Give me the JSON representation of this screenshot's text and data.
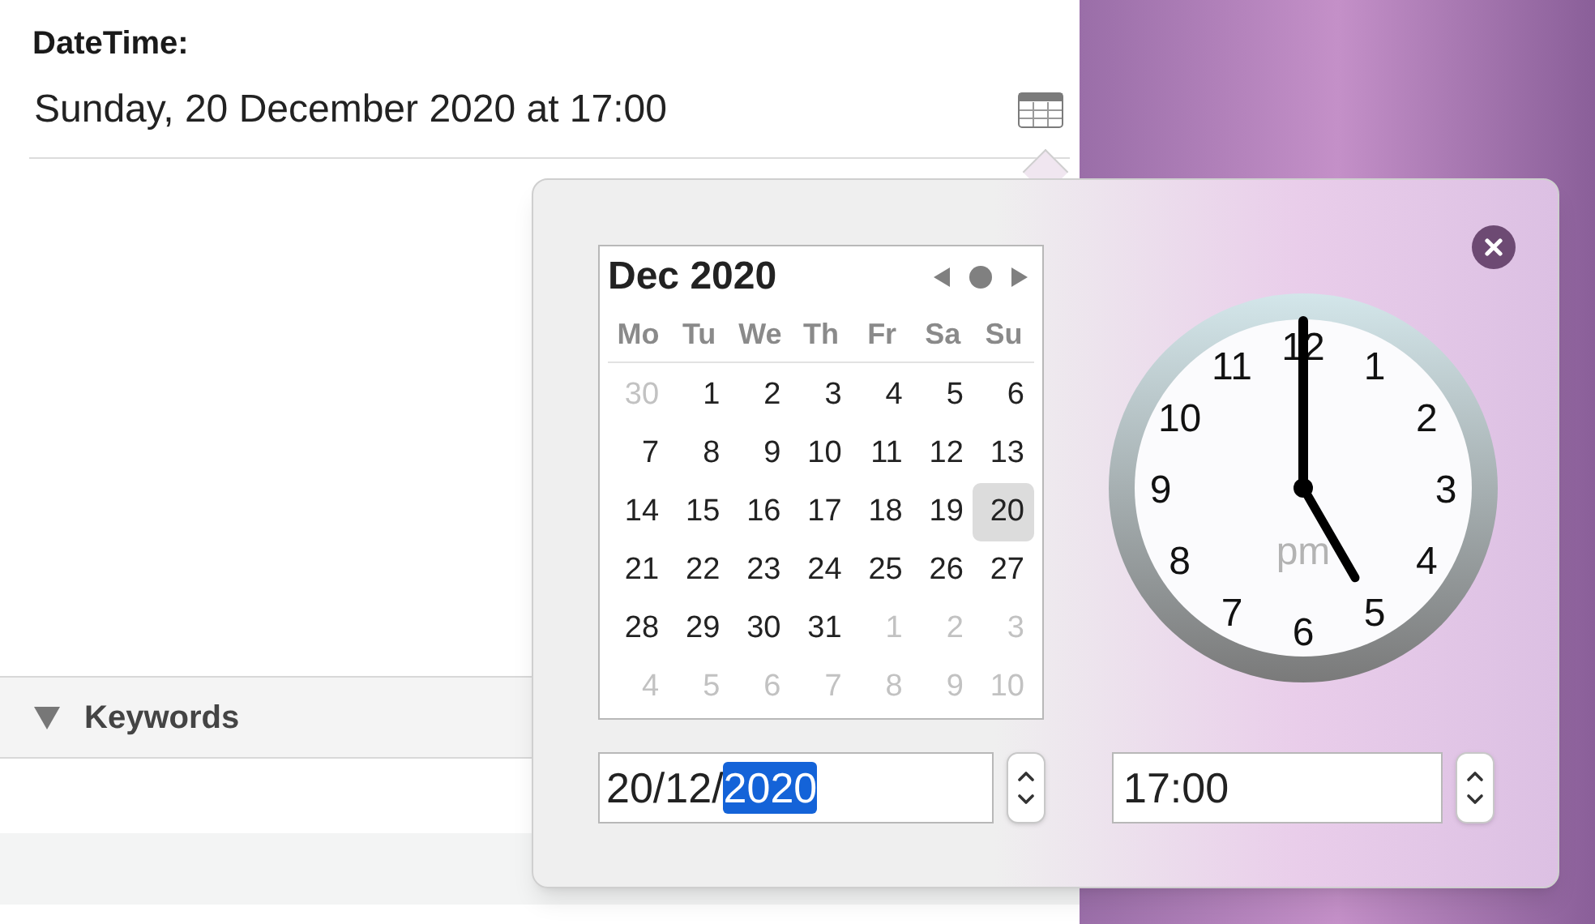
{
  "field": {
    "label": "DateTime:",
    "value": "Sunday, 20 December 2020 at 17:00"
  },
  "section": {
    "title": "Keywords",
    "expanded": true
  },
  "popover": {
    "calendar": {
      "title": "Dec 2020",
      "weekdays": [
        "Mo",
        "Tu",
        "We",
        "Th",
        "Fr",
        "Sa",
        "Su"
      ],
      "days": [
        {
          "label": "30",
          "muted": true,
          "selected": false
        },
        {
          "label": "1",
          "muted": false,
          "selected": false
        },
        {
          "label": "2",
          "muted": false,
          "selected": false
        },
        {
          "label": "3",
          "muted": false,
          "selected": false
        },
        {
          "label": "4",
          "muted": false,
          "selected": false
        },
        {
          "label": "5",
          "muted": false,
          "selected": false
        },
        {
          "label": "6",
          "muted": false,
          "selected": false
        },
        {
          "label": "7",
          "muted": false,
          "selected": false
        },
        {
          "label": "8",
          "muted": false,
          "selected": false
        },
        {
          "label": "9",
          "muted": false,
          "selected": false
        },
        {
          "label": "10",
          "muted": false,
          "selected": false
        },
        {
          "label": "11",
          "muted": false,
          "selected": false
        },
        {
          "label": "12",
          "muted": false,
          "selected": false
        },
        {
          "label": "13",
          "muted": false,
          "selected": false
        },
        {
          "label": "14",
          "muted": false,
          "selected": false
        },
        {
          "label": "15",
          "muted": false,
          "selected": false
        },
        {
          "label": "16",
          "muted": false,
          "selected": false
        },
        {
          "label": "17",
          "muted": false,
          "selected": false
        },
        {
          "label": "18",
          "muted": false,
          "selected": false
        },
        {
          "label": "19",
          "muted": false,
          "selected": false
        },
        {
          "label": "20",
          "muted": false,
          "selected": true
        },
        {
          "label": "21",
          "muted": false,
          "selected": false
        },
        {
          "label": "22",
          "muted": false,
          "selected": false
        },
        {
          "label": "23",
          "muted": false,
          "selected": false
        },
        {
          "label": "24",
          "muted": false,
          "selected": false
        },
        {
          "label": "25",
          "muted": false,
          "selected": false
        },
        {
          "label": "26",
          "muted": false,
          "selected": false
        },
        {
          "label": "27",
          "muted": false,
          "selected": false
        },
        {
          "label": "28",
          "muted": false,
          "selected": false
        },
        {
          "label": "29",
          "muted": false,
          "selected": false
        },
        {
          "label": "30",
          "muted": false,
          "selected": false
        },
        {
          "label": "31",
          "muted": false,
          "selected": false
        },
        {
          "label": "1",
          "muted": true,
          "selected": false
        },
        {
          "label": "2",
          "muted": true,
          "selected": false
        },
        {
          "label": "3",
          "muted": true,
          "selected": false
        },
        {
          "label": "4",
          "muted": true,
          "selected": false
        },
        {
          "label": "5",
          "muted": true,
          "selected": false
        },
        {
          "label": "6",
          "muted": true,
          "selected": false
        },
        {
          "label": "7",
          "muted": true,
          "selected": false
        },
        {
          "label": "8",
          "muted": true,
          "selected": false
        },
        {
          "label": "9",
          "muted": true,
          "selected": false
        },
        {
          "label": "10",
          "muted": true,
          "selected": false
        }
      ]
    },
    "clock": {
      "period": "pm",
      "numbers": [
        "12",
        "1",
        "2",
        "3",
        "4",
        "5",
        "6",
        "7",
        "8",
        "9",
        "10",
        "11"
      ]
    },
    "date_input": {
      "text": "20/12/",
      "selected_text": "2020"
    },
    "time_input": {
      "value": "17:00"
    }
  }
}
